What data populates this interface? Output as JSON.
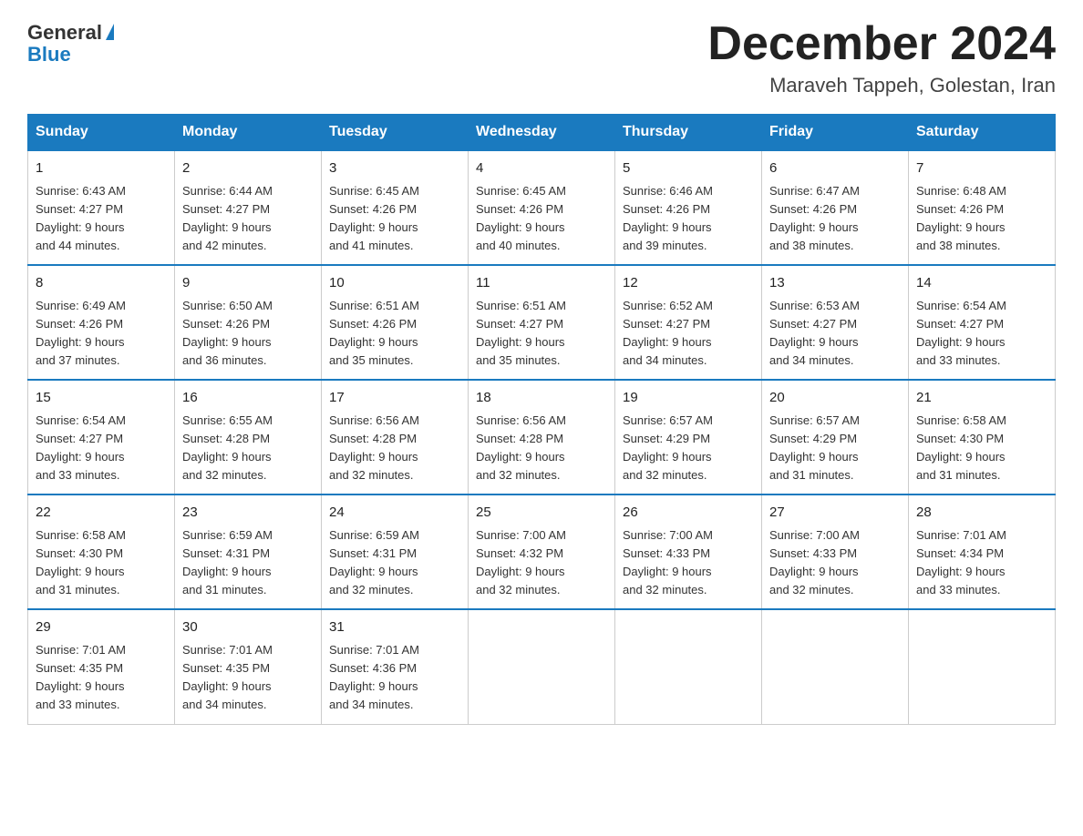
{
  "header": {
    "logo_general": "General",
    "logo_blue": "Blue",
    "month_title": "December 2024",
    "location": "Maraveh Tappeh, Golestan, Iran"
  },
  "days_of_week": [
    "Sunday",
    "Monday",
    "Tuesday",
    "Wednesday",
    "Thursday",
    "Friday",
    "Saturday"
  ],
  "weeks": [
    [
      {
        "day": "1",
        "sunrise": "6:43 AM",
        "sunset": "4:27 PM",
        "daylight": "9 hours and 44 minutes."
      },
      {
        "day": "2",
        "sunrise": "6:44 AM",
        "sunset": "4:27 PM",
        "daylight": "9 hours and 42 minutes."
      },
      {
        "day": "3",
        "sunrise": "6:45 AM",
        "sunset": "4:26 PM",
        "daylight": "9 hours and 41 minutes."
      },
      {
        "day": "4",
        "sunrise": "6:45 AM",
        "sunset": "4:26 PM",
        "daylight": "9 hours and 40 minutes."
      },
      {
        "day": "5",
        "sunrise": "6:46 AM",
        "sunset": "4:26 PM",
        "daylight": "9 hours and 39 minutes."
      },
      {
        "day": "6",
        "sunrise": "6:47 AM",
        "sunset": "4:26 PM",
        "daylight": "9 hours and 38 minutes."
      },
      {
        "day": "7",
        "sunrise": "6:48 AM",
        "sunset": "4:26 PM",
        "daylight": "9 hours and 38 minutes."
      }
    ],
    [
      {
        "day": "8",
        "sunrise": "6:49 AM",
        "sunset": "4:26 PM",
        "daylight": "9 hours and 37 minutes."
      },
      {
        "day": "9",
        "sunrise": "6:50 AM",
        "sunset": "4:26 PM",
        "daylight": "9 hours and 36 minutes."
      },
      {
        "day": "10",
        "sunrise": "6:51 AM",
        "sunset": "4:26 PM",
        "daylight": "9 hours and 35 minutes."
      },
      {
        "day": "11",
        "sunrise": "6:51 AM",
        "sunset": "4:27 PM",
        "daylight": "9 hours and 35 minutes."
      },
      {
        "day": "12",
        "sunrise": "6:52 AM",
        "sunset": "4:27 PM",
        "daylight": "9 hours and 34 minutes."
      },
      {
        "day": "13",
        "sunrise": "6:53 AM",
        "sunset": "4:27 PM",
        "daylight": "9 hours and 34 minutes."
      },
      {
        "day": "14",
        "sunrise": "6:54 AM",
        "sunset": "4:27 PM",
        "daylight": "9 hours and 33 minutes."
      }
    ],
    [
      {
        "day": "15",
        "sunrise": "6:54 AM",
        "sunset": "4:27 PM",
        "daylight": "9 hours and 33 minutes."
      },
      {
        "day": "16",
        "sunrise": "6:55 AM",
        "sunset": "4:28 PM",
        "daylight": "9 hours and 32 minutes."
      },
      {
        "day": "17",
        "sunrise": "6:56 AM",
        "sunset": "4:28 PM",
        "daylight": "9 hours and 32 minutes."
      },
      {
        "day": "18",
        "sunrise": "6:56 AM",
        "sunset": "4:28 PM",
        "daylight": "9 hours and 32 minutes."
      },
      {
        "day": "19",
        "sunrise": "6:57 AM",
        "sunset": "4:29 PM",
        "daylight": "9 hours and 32 minutes."
      },
      {
        "day": "20",
        "sunrise": "6:57 AM",
        "sunset": "4:29 PM",
        "daylight": "9 hours and 31 minutes."
      },
      {
        "day": "21",
        "sunrise": "6:58 AM",
        "sunset": "4:30 PM",
        "daylight": "9 hours and 31 minutes."
      }
    ],
    [
      {
        "day": "22",
        "sunrise": "6:58 AM",
        "sunset": "4:30 PM",
        "daylight": "9 hours and 31 minutes."
      },
      {
        "day": "23",
        "sunrise": "6:59 AM",
        "sunset": "4:31 PM",
        "daylight": "9 hours and 31 minutes."
      },
      {
        "day": "24",
        "sunrise": "6:59 AM",
        "sunset": "4:31 PM",
        "daylight": "9 hours and 32 minutes."
      },
      {
        "day": "25",
        "sunrise": "7:00 AM",
        "sunset": "4:32 PM",
        "daylight": "9 hours and 32 minutes."
      },
      {
        "day": "26",
        "sunrise": "7:00 AM",
        "sunset": "4:33 PM",
        "daylight": "9 hours and 32 minutes."
      },
      {
        "day": "27",
        "sunrise": "7:00 AM",
        "sunset": "4:33 PM",
        "daylight": "9 hours and 32 minutes."
      },
      {
        "day": "28",
        "sunrise": "7:01 AM",
        "sunset": "4:34 PM",
        "daylight": "9 hours and 33 minutes."
      }
    ],
    [
      {
        "day": "29",
        "sunrise": "7:01 AM",
        "sunset": "4:35 PM",
        "daylight": "9 hours and 33 minutes."
      },
      {
        "day": "30",
        "sunrise": "7:01 AM",
        "sunset": "4:35 PM",
        "daylight": "9 hours and 34 minutes."
      },
      {
        "day": "31",
        "sunrise": "7:01 AM",
        "sunset": "4:36 PM",
        "daylight": "9 hours and 34 minutes."
      },
      null,
      null,
      null,
      null
    ]
  ],
  "labels": {
    "sunrise": "Sunrise:",
    "sunset": "Sunset:",
    "daylight": "Daylight:"
  }
}
